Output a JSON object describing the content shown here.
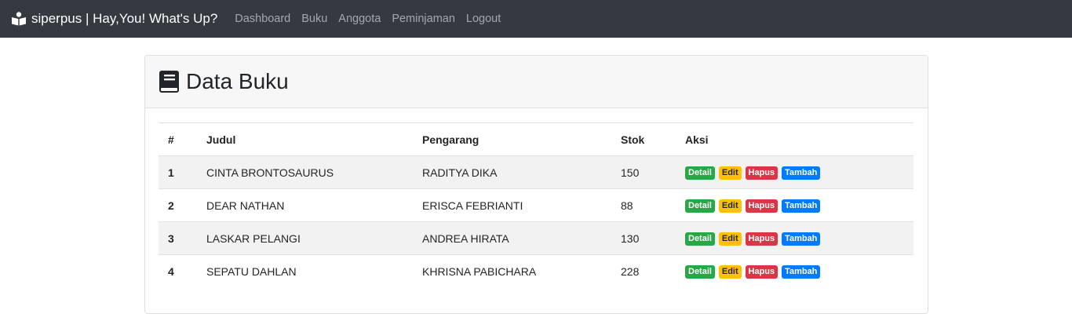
{
  "navbar": {
    "brand": "siperpus | Hay,You! What's Up?",
    "links": [
      "Dashboard",
      "Buku",
      "Anggota",
      "Peminjaman",
      "Logout"
    ]
  },
  "card": {
    "title": "Data Buku",
    "table": {
      "headers": [
        "#",
        "Judul",
        "Pengarang",
        "Stok",
        "Aksi"
      ],
      "rows": [
        {
          "no": "1",
          "judul": "CINTA BRONTOSAURUS",
          "pengarang": "RADITYA DIKA",
          "stok": "150"
        },
        {
          "no": "2",
          "judul": "DEAR NATHAN",
          "pengarang": "ERISCA FEBRIANTI",
          "stok": "88"
        },
        {
          "no": "3",
          "judul": "LASKAR PELANGI",
          "pengarang": "ANDREA HIRATA",
          "stok": "130"
        },
        {
          "no": "4",
          "judul": "SEPATU DAHLAN",
          "pengarang": "KHRISNA PABICHARA",
          "stok": "228"
        }
      ],
      "actions": [
        "Detail",
        "Edit",
        "Hapus",
        "Tambah"
      ]
    }
  },
  "colors": {
    "navbar_bg": "#343a40",
    "detail": "#28a745",
    "edit": "#ffc107",
    "hapus": "#dc3545",
    "tambah": "#007bff"
  }
}
